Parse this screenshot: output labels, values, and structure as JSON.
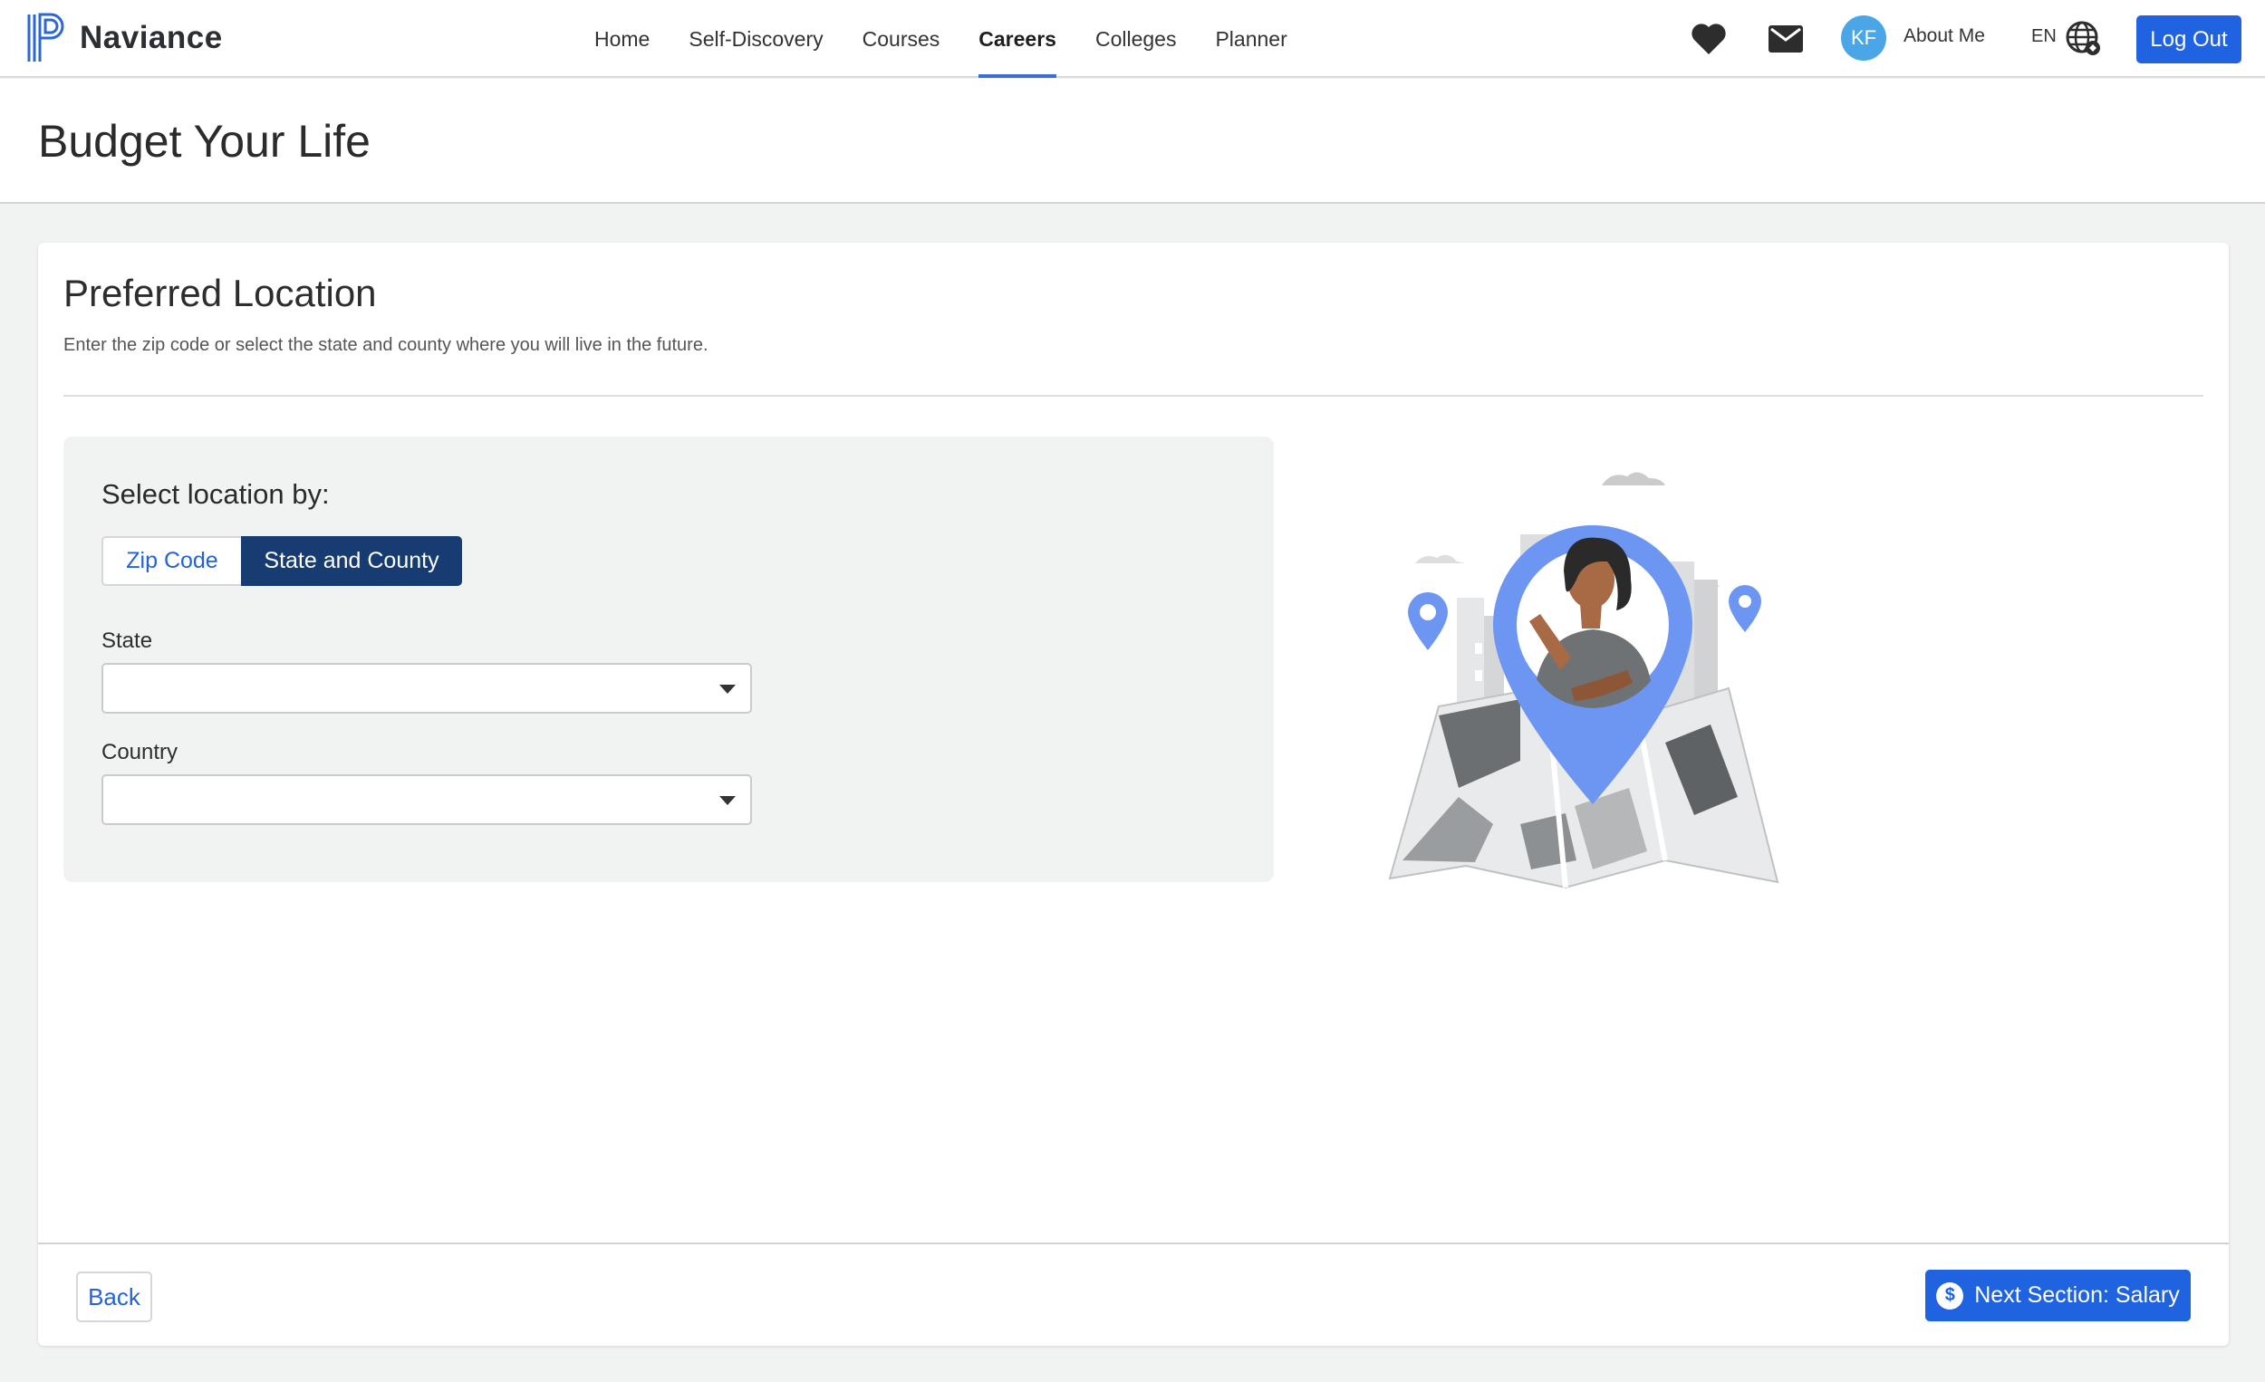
{
  "app": {
    "name": "Naviance"
  },
  "nav": {
    "links": [
      {
        "label": "Home",
        "active": false
      },
      {
        "label": "Self-Discovery",
        "active": false
      },
      {
        "label": "Courses",
        "active": false
      },
      {
        "label": "Careers",
        "active": true
      },
      {
        "label": "Colleges",
        "active": false
      },
      {
        "label": "Planner",
        "active": false
      }
    ],
    "avatar_initials": "KF",
    "about_me": "About Me",
    "language": "EN",
    "logout": "Log Out",
    "icons": [
      "heart-icon",
      "mail-icon",
      "globe-icon"
    ]
  },
  "page": {
    "title": "Budget Your Life"
  },
  "section": {
    "title": "Preferred Location",
    "description": "Enter the zip code or select the state and county where you will live in the future."
  },
  "location_panel": {
    "heading": "Select location by:",
    "options": [
      "Zip Code",
      "State and County"
    ],
    "selected_option": "State and County",
    "fields": [
      {
        "label": "State",
        "value": ""
      },
      {
        "label": "Country",
        "value": ""
      }
    ]
  },
  "footer": {
    "back": "Back",
    "next": "Next Section: Salary"
  },
  "colors": {
    "primary": "#1f63e1",
    "segment_active": "#173c72",
    "active_tab_underline": "#3b6ed9",
    "avatar": "#4aa6e6",
    "pin": "#6d95f2"
  }
}
